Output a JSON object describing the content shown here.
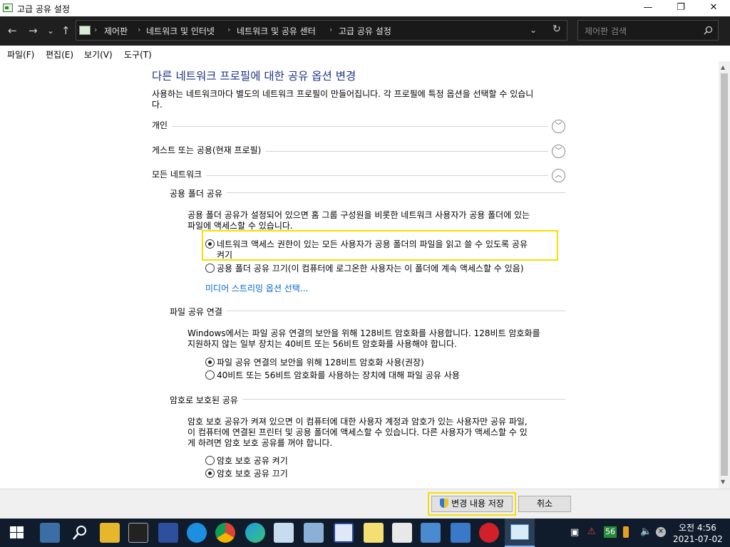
{
  "window": {
    "title": "고급 공유 설정",
    "minimize": "—",
    "maximize": "❐",
    "close": "✕"
  },
  "nav": {
    "back": "←",
    "forward": "→",
    "recent": "⌄",
    "up": "↑",
    "dropdown": "⌄",
    "refresh": "↻"
  },
  "breadcrumbs": [
    "제어판",
    "네트워크 및 인터넷",
    "네트워크 및 공유 센터",
    "고급 공유 설정"
  ],
  "search": {
    "placeholder": "제어판 검색"
  },
  "menu": [
    "파일(F)",
    "편집(E)",
    "보기(V)",
    "도구(T)"
  ],
  "page": {
    "heading": "다른 네트워크 프로필에 대한 공유 옵션 변경",
    "intro_line1": "사용하는 네트워크마다 별도의 네트워크 프로필이 만들어집니다. 각 프로필에 특정 옵션을 선택할 수 있습니",
    "intro_line2": "다.",
    "profiles": {
      "private": "개인",
      "guest": "게스트 또는 공용(현재 프로필)",
      "all": "모든 네트워크"
    },
    "public_folder": {
      "title": "공용 폴더 공유",
      "desc1": "공용 폴더 공유가 설정되어 있으면 홈 그룹 구성원을 비롯한 네트워크 사용자가 공용 폴더에 있는",
      "desc2": "파일에 액세스할 수 있습니다.",
      "opt_on_line1": "네트워크 액세스 권한이 있는 모든 사용자가 공용 폴더의 파일을 읽고 쓸 수 있도록 공유",
      "opt_on_line2": "켜기",
      "opt_off": "공용 폴더 공유 끄기(이 컴퓨터에 로그온한 사용자는 이 폴더에 계속 액세스할 수 있음)",
      "selected": "on",
      "media_link": "미디어 스트리밍 옵션 선택..."
    },
    "file_sharing": {
      "title": "파일 공유 연결",
      "desc1": "Windows에서는 파일 공유 연결의 보안을 위해 128비트 암호화를 사용합니다. 128비트 암호화를",
      "desc2": "지원하지 않는 일부 장치는 40비트 또는 56비트 암호화를 사용해야 합니다.",
      "opt_128": "파일 공유 연결의 보안을 위해 128비트 암호화 사용(권장)",
      "opt_40": "40비트 또는 56비트 암호화를 사용하는 장치에 대해 파일 공유 사용",
      "selected": "128"
    },
    "password": {
      "title": "암호로 보호된 공유",
      "desc1": "암호 보호 공유가 켜져 있으면 이 컴퓨터에 대한 사용자 계정과 암호가 있는 사용자만 공유 파일,",
      "desc2": "이 컴퓨터에 연결된 프린터 및 공용 폴더에 액세스할 수 있습니다. 다른 사용자가 액세스할 수 있",
      "desc3": "게 하려면 암호 보호 공유를 꺼야 합니다.",
      "opt_on": "암호 보호 공유 켜기",
      "opt_off": "암호 보호 공유 끄기",
      "selected": "off"
    }
  },
  "buttons": {
    "save": "변경 내용 저장",
    "cancel": "취소"
  },
  "taskbar": {
    "time": "오전 4:56",
    "date": "2021-07-02",
    "badge": "56"
  },
  "colors": {
    "heading": "#1e3287",
    "link": "#0066cc",
    "highlight": "#f5e000",
    "taskbar": "#101c2c"
  }
}
